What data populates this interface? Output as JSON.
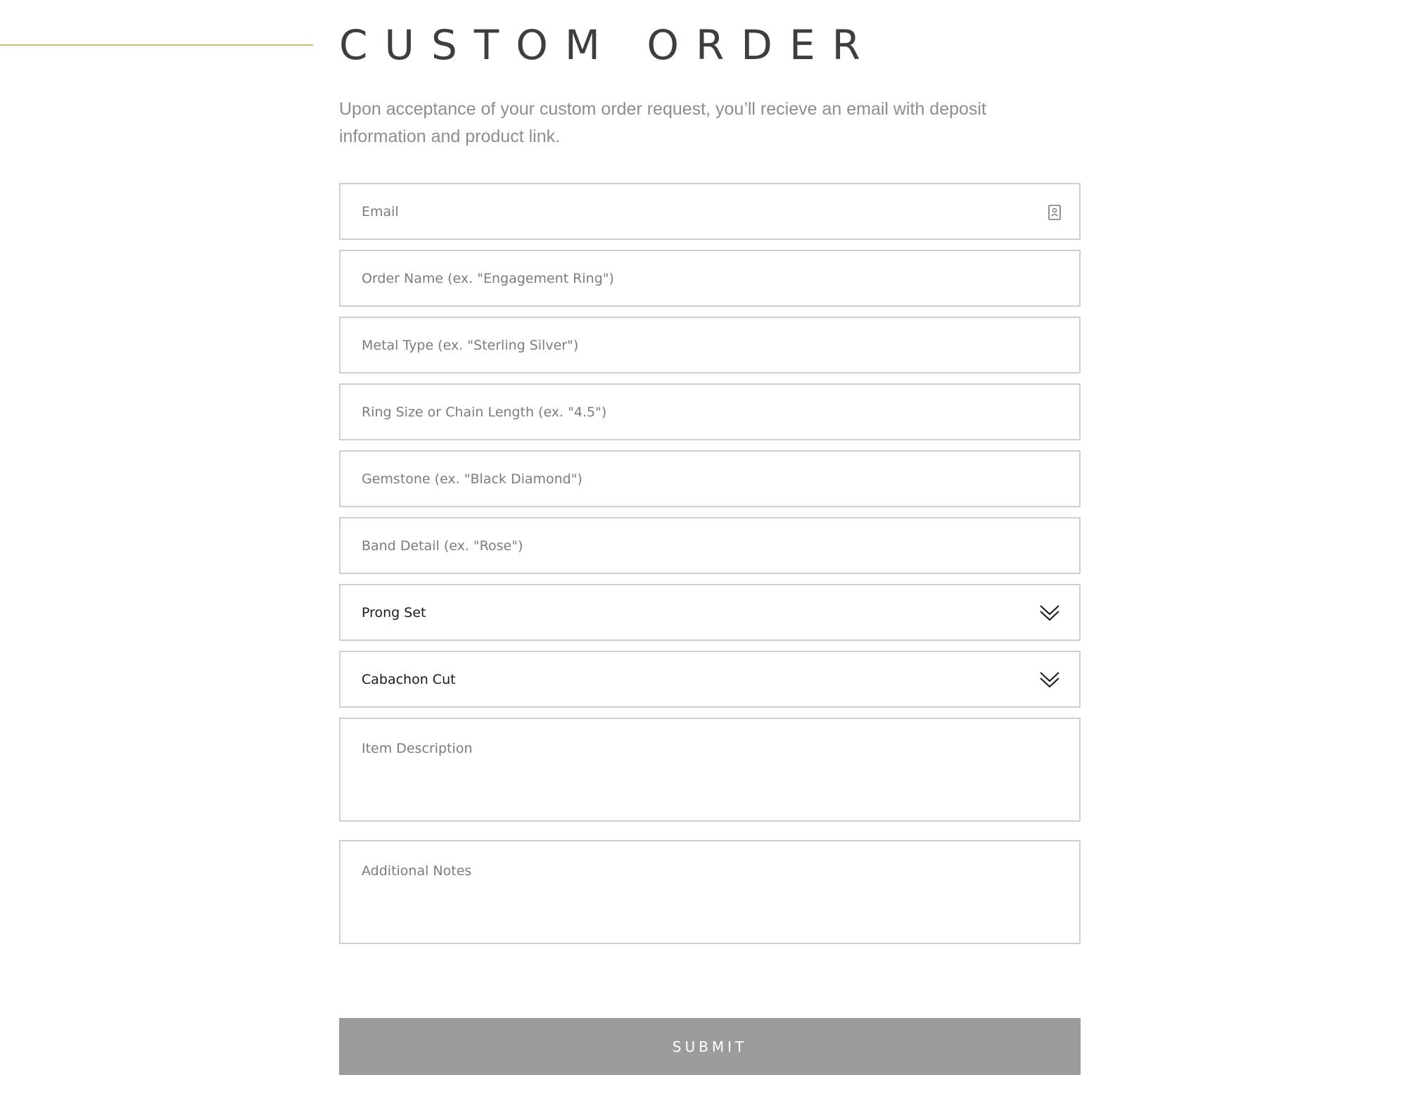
{
  "header": {
    "title": "CUSTOM ORDER",
    "intro": "Upon acceptance of your custom order request, you’ll recieve an email with deposit information and product link."
  },
  "form": {
    "email": {
      "placeholder": "Email",
      "value": "",
      "icon": "contact-card-icon"
    },
    "order_name": {
      "placeholder": "Order Name (ex. \"Engagement Ring\")",
      "value": ""
    },
    "metal_type": {
      "placeholder": "Metal Type (ex. \"Sterling Silver\")",
      "value": ""
    },
    "ring_size": {
      "placeholder": "Ring Size or Chain Length (ex. \"4.5\")",
      "value": ""
    },
    "gemstone": {
      "placeholder": "Gemstone (ex. \"Black Diamond\")",
      "value": ""
    },
    "band_detail": {
      "placeholder": "Band Detail (ex. \"Rose\")",
      "value": ""
    },
    "setting": {
      "selected": "Prong Set",
      "icon": "double-chevron-down-icon"
    },
    "cut": {
      "selected": "Cabachon Cut",
      "icon": "double-chevron-down-icon"
    },
    "item_description": {
      "placeholder": "Item Description",
      "value": ""
    },
    "additional_notes": {
      "placeholder": "Additional Notes",
      "value": ""
    }
  },
  "actions": {
    "submit_label": "SUBMIT"
  },
  "colors": {
    "accent_line": "#c8c17c",
    "title": "#3e3e3e",
    "intro_text": "#8d8d8d",
    "field_border": "#cfcfcf",
    "placeholder": "#7c7c7c",
    "submit_background": "#9b9b9b",
    "submit_text": "#ffffff"
  }
}
